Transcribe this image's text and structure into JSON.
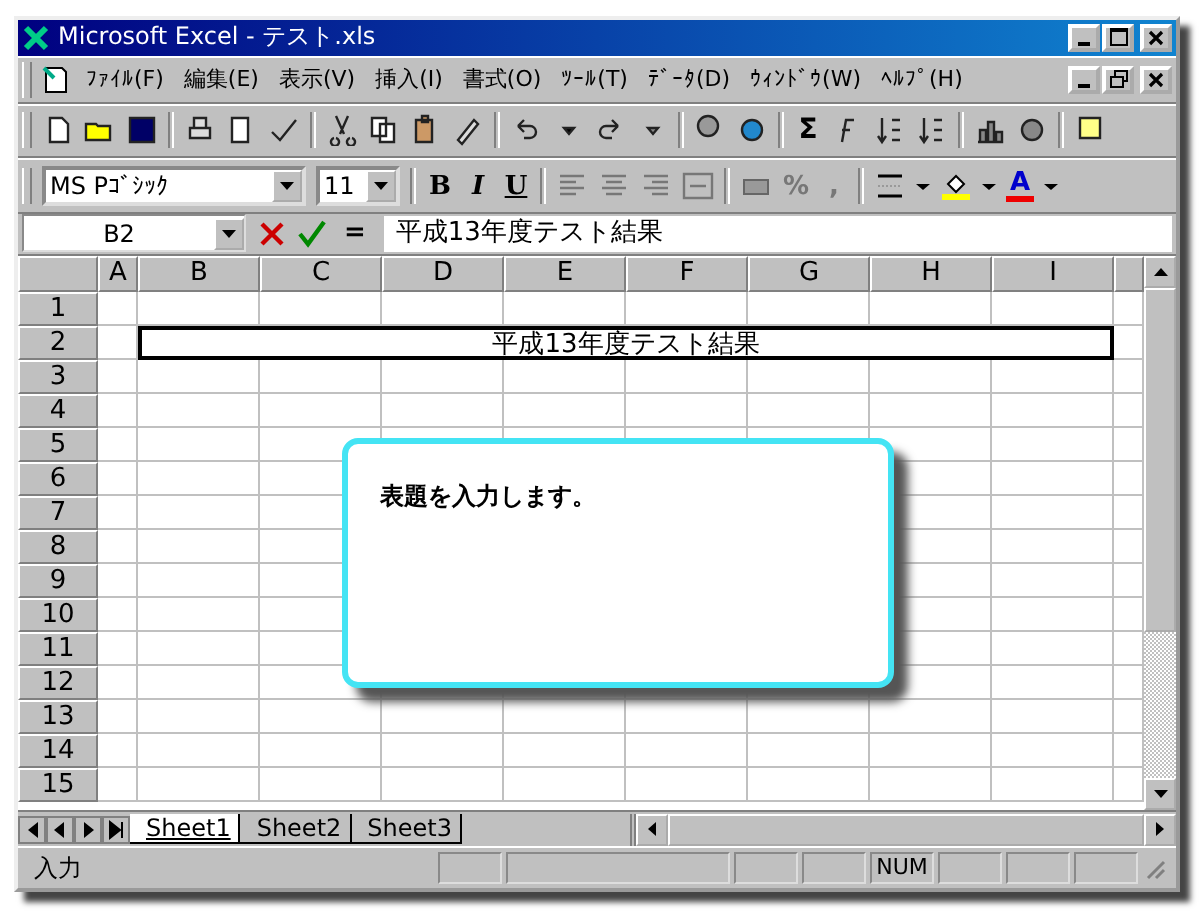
{
  "window": {
    "title": "Microsoft Excel - テスト.xls"
  },
  "menu": [
    "ﾌｧｲﾙ(F)",
    "編集(E)",
    "表示(V)",
    "挿入(I)",
    "書式(O)",
    "ﾂｰﾙ(T)",
    "ﾃﾞｰﾀ(D)",
    "ｳｨﾝﾄﾞｳ(W)",
    "ﾍﾙﾌﾟ(H)"
  ],
  "standard_toolbar": {
    "sum_label": "Σ"
  },
  "format_toolbar": {
    "font": "MS Pｺﾞｼｯｸ",
    "size": "11",
    "bold": "B",
    "italic": "I",
    "underline": "U",
    "percent": "%",
    "comma": ",",
    "font_color_label": "A"
  },
  "formula_bar": {
    "name_box": "B2",
    "equals": "=",
    "formula": "平成13年度テスト結果"
  },
  "sheet": {
    "columns": [
      "A",
      "B",
      "C",
      "D",
      "E",
      "F",
      "G",
      "H",
      "I"
    ],
    "rows": [
      {
        "header": "1"
      },
      {
        "header": "2",
        "merged_cell": {
          "text": "平成13年度テスト結果",
          "selected": true
        }
      },
      {
        "header": "3"
      },
      {
        "header": "4"
      },
      {
        "header": "5"
      },
      {
        "header": "6"
      },
      {
        "header": "7"
      },
      {
        "header": "8"
      },
      {
        "header": "9"
      },
      {
        "header": "10"
      },
      {
        "header": "11"
      },
      {
        "header": "12"
      },
      {
        "header": "13"
      },
      {
        "header": "14"
      },
      {
        "header": "15"
      }
    ]
  },
  "callout": {
    "text": "表題を入力します。"
  },
  "sheet_tabs": [
    {
      "label": "Sheet1",
      "selected": true
    },
    {
      "label": "Sheet2",
      "selected": false
    },
    {
      "label": "Sheet3",
      "selected": false
    }
  ],
  "status_bar": {
    "mode": "入力",
    "num_indicator": "NUM"
  }
}
